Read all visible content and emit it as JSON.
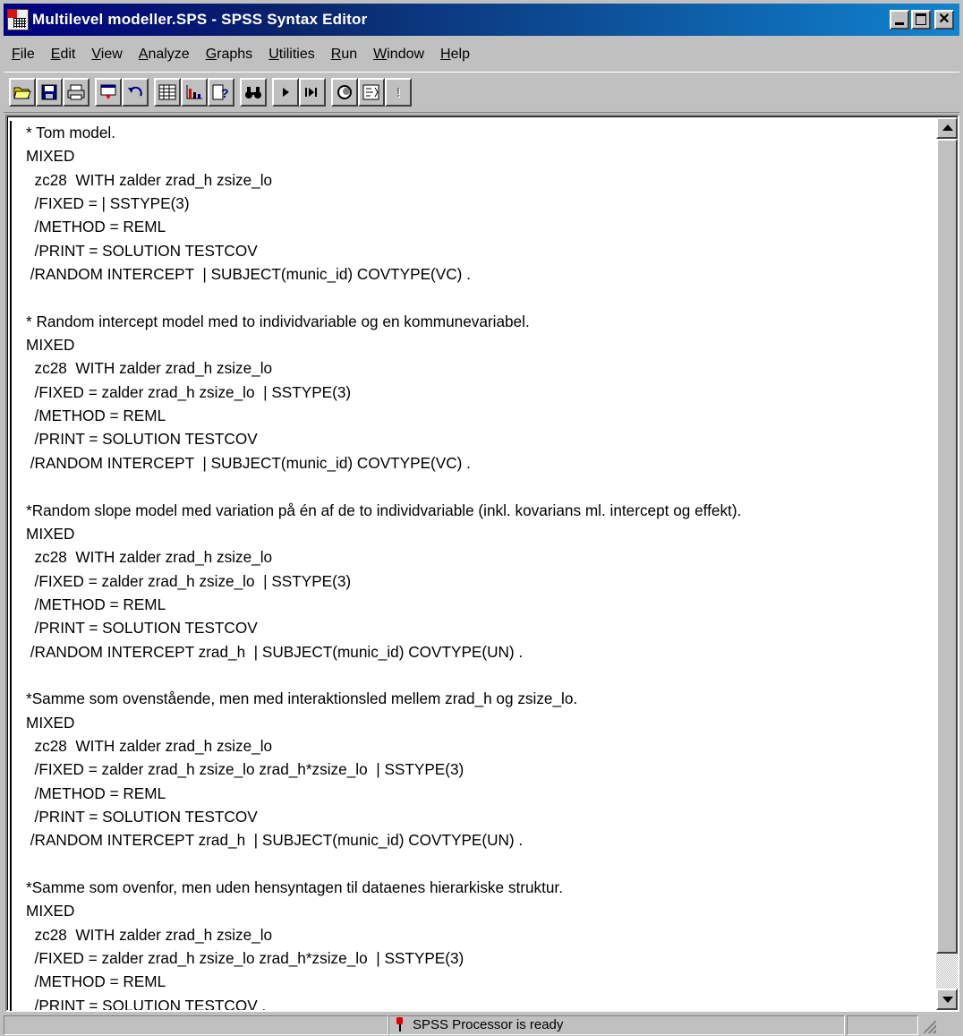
{
  "window": {
    "title": "Multilevel modeller.SPS - SPSS Syntax Editor",
    "close_glyph": "✕"
  },
  "menu": [
    {
      "accel": "F",
      "rest": "ile"
    },
    {
      "accel": "E",
      "rest": "dit"
    },
    {
      "accel": "V",
      "rest": "iew"
    },
    {
      "accel": "A",
      "rest": "nalyze"
    },
    {
      "accel": "G",
      "rest": "raphs"
    },
    {
      "accel": "U",
      "rest": "tilities"
    },
    {
      "accel": "R",
      "rest": "un"
    },
    {
      "accel": "W",
      "rest": "indow"
    },
    {
      "accel": "H",
      "rest": "elp"
    }
  ],
  "toolbar": {
    "icons": [
      "open-folder-icon",
      "save-disk-icon",
      "print-icon",
      "dialog-recall-icon",
      "undo-icon",
      "goto-data-icon",
      "goto-chart-icon",
      "variables-icon",
      "find-icon",
      "run-current-icon",
      "run-all-icon",
      "use-sets-icon",
      "designate-window-icon",
      "help-icon"
    ],
    "help_glyph": "!"
  },
  "editor": {
    "lines": [
      "* Tom model.",
      "MIXED",
      "  zc28  WITH zalder zrad_h zsize_lo",
      "  /FIXED = | SSTYPE(3)",
      "  /METHOD = REML",
      "  /PRINT = SOLUTION TESTCOV",
      " /RANDOM INTERCEPT  | SUBJECT(munic_id) COVTYPE(VC) .",
      "",
      "* Random intercept model med to individvariable og en kommunevariabel.",
      "MIXED",
      "  zc28  WITH zalder zrad_h zsize_lo",
      "  /FIXED = zalder zrad_h zsize_lo  | SSTYPE(3)",
      "  /METHOD = REML",
      "  /PRINT = SOLUTION TESTCOV",
      " /RANDOM INTERCEPT  | SUBJECT(munic_id) COVTYPE(VC) .",
      "",
      "*Random slope model med variation på én af de to individvariable (inkl. kovarians ml. intercept og effekt).",
      "MIXED",
      "  zc28  WITH zalder zrad_h zsize_lo",
      "  /FIXED = zalder zrad_h zsize_lo  | SSTYPE(3)",
      "  /METHOD = REML",
      "  /PRINT = SOLUTION TESTCOV",
      " /RANDOM INTERCEPT zrad_h  | SUBJECT(munic_id) COVTYPE(UN) .",
      "",
      "*Samme som ovenstående, men med interaktionsled mellem zrad_h og zsize_lo.",
      "MIXED",
      "  zc28  WITH zalder zrad_h zsize_lo",
      "  /FIXED = zalder zrad_h zsize_lo zrad_h*zsize_lo  | SSTYPE(3)",
      "  /METHOD = REML",
      "  /PRINT = SOLUTION TESTCOV",
      " /RANDOM INTERCEPT zrad_h  | SUBJECT(munic_id) COVTYPE(UN) .",
      "",
      "*Samme som ovenfor, men uden hensyntagen til dataenes hierarkiske struktur.",
      "MIXED",
      "  zc28  WITH zalder zrad_h zsize_lo",
      "  /FIXED = zalder zrad_h zsize_lo zrad_h*zsize_lo  | SSTYPE(3)",
      "  /METHOD = REML",
      "  /PRINT = SOLUTION TESTCOV ."
    ]
  },
  "status": {
    "message": "SPSS Processor  is ready"
  }
}
